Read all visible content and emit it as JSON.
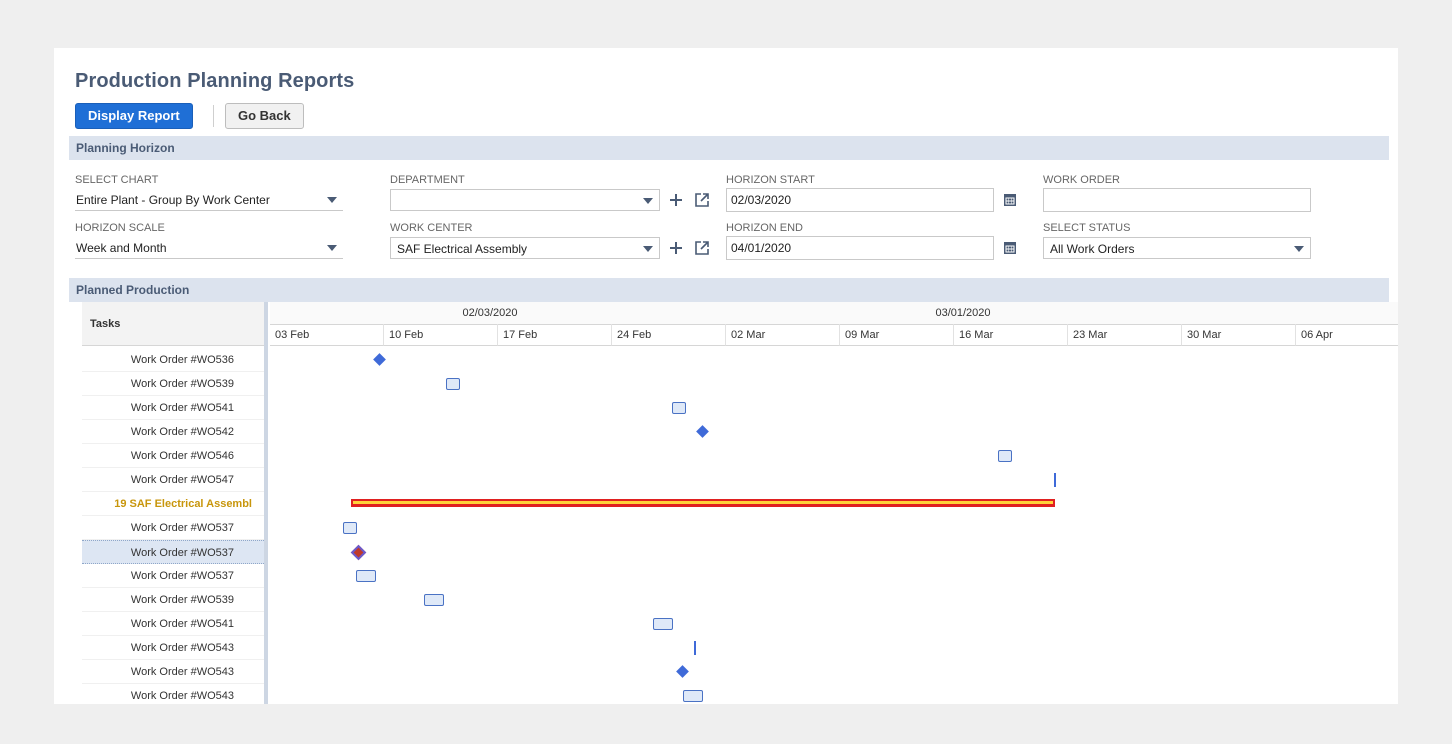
{
  "page": {
    "title": "Production Planning Reports"
  },
  "toolbar": {
    "display_report": "Display Report",
    "go_back": "Go Back"
  },
  "sections": {
    "planning_horizon": "Planning Horizon",
    "planned_production": "Planned Production"
  },
  "filters": {
    "select_chart": {
      "label": "SELECT CHART",
      "value": "Entire Plant - Group By Work Center"
    },
    "horizon_scale": {
      "label": "HORIZON SCALE",
      "value": "Week and Month"
    },
    "department": {
      "label": "DEPARTMENT",
      "value": ""
    },
    "work_center": {
      "label": "WORK CENTER",
      "value": "SAF Electrical Assembly"
    },
    "horizon_start": {
      "label": "HORIZON START",
      "value": "02/03/2020"
    },
    "horizon_end": {
      "label": "HORIZON END",
      "value": "04/01/2020"
    },
    "work_order": {
      "label": "WORK ORDER",
      "value": ""
    },
    "select_status": {
      "label": "SELECT STATUS",
      "value": "All Work Orders"
    }
  },
  "gantt": {
    "tasks_header": "Tasks",
    "months": [
      "02/03/2020",
      "03/01/2020",
      ""
    ],
    "weeks": [
      "03 Feb",
      "10 Feb",
      "17 Feb",
      "24 Feb",
      "02 Mar",
      "09 Mar",
      "16 Mar",
      "23 Mar",
      "30 Mar",
      "06 Apr"
    ],
    "tasks": [
      {
        "label": "Work Order #WO536",
        "mark": "diamond"
      },
      {
        "label": "Work Order #WO539",
        "mark": "box"
      },
      {
        "label": "Work Order #WO541",
        "mark": "box"
      },
      {
        "label": "Work Order #WO542",
        "mark": "diamond"
      },
      {
        "label": "Work Order #WO546",
        "mark": "box"
      },
      {
        "label": "Work Order #WO547",
        "mark": "tick"
      },
      {
        "label": "19 SAF Electrical Assembl",
        "mark": "summary",
        "group": true
      },
      {
        "label": "Work Order #WO537",
        "mark": "box"
      },
      {
        "label": "Work Order #WO537",
        "mark": "diamond-red",
        "selected": true
      },
      {
        "label": "Work Order #WO537",
        "mark": "box"
      },
      {
        "label": "Work Order #WO539",
        "mark": "box"
      },
      {
        "label": "Work Order #WO541",
        "mark": "box"
      },
      {
        "label": "Work Order #WO543",
        "mark": "tick"
      },
      {
        "label": "Work Order #WO543",
        "mark": "diamond"
      },
      {
        "label": "Work Order #WO543",
        "mark": "box"
      }
    ]
  },
  "colors": {
    "accent": "#1f6fd6",
    "section_bg": "#dce3ee",
    "summary_fill": "#ffd23a",
    "summary_border": "#e02020",
    "milestone": "#3f6ad8"
  }
}
